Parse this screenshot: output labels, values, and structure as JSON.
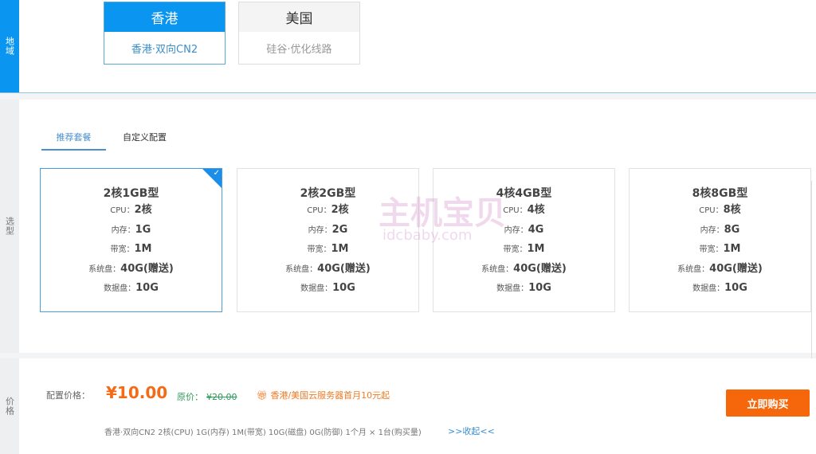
{
  "sections": {
    "region": "地域",
    "select": "选型",
    "price": "价格"
  },
  "regions": [
    {
      "name": "香港",
      "line": "香港·双向CN2"
    },
    {
      "name": "美国",
      "line": "硅谷·优化线路"
    }
  ],
  "tabs": [
    "推荐套餐",
    "自定义配置"
  ],
  "labels": {
    "cpu": "CPU：",
    "mem": "内存：",
    "bw": "带宽：",
    "sys": "系统盘：",
    "data": "数据盘："
  },
  "plans": [
    {
      "title": "2核1GB型",
      "cpu": "2核",
      "mem": "1G",
      "bw": "1M",
      "sys": "40G(赠送)",
      "data": "10G"
    },
    {
      "title": "2核2GB型",
      "cpu": "2核",
      "mem": "2G",
      "bw": "1M",
      "sys": "40G(赠送)",
      "data": "10G"
    },
    {
      "title": "4核4GB型",
      "cpu": "4核",
      "mem": "4G",
      "bw": "1M",
      "sys": "40G(赠送)",
      "data": "10G"
    },
    {
      "title": "8核8GB型",
      "cpu": "8核",
      "mem": "8G",
      "bw": "1M",
      "sys": "40G(赠送)",
      "data": "10G"
    }
  ],
  "watermark": {
    "text": "主机宝贝",
    "url": "idcbaby.com"
  },
  "pricing": {
    "label": "配置价格：",
    "price": "¥10.00",
    "orig_label": "原价：",
    "orig_price": "¥20.00",
    "promo": "香港/美国云服务器首月10元起",
    "summary": "香港·双向CN2  2核(CPU)  1G(内存)  1M(带宽)  10G(磁盘)  0G(防御)  1个月 × 1台(购买量)",
    "toggle": ">>收起<<",
    "buy": "立即购买"
  }
}
